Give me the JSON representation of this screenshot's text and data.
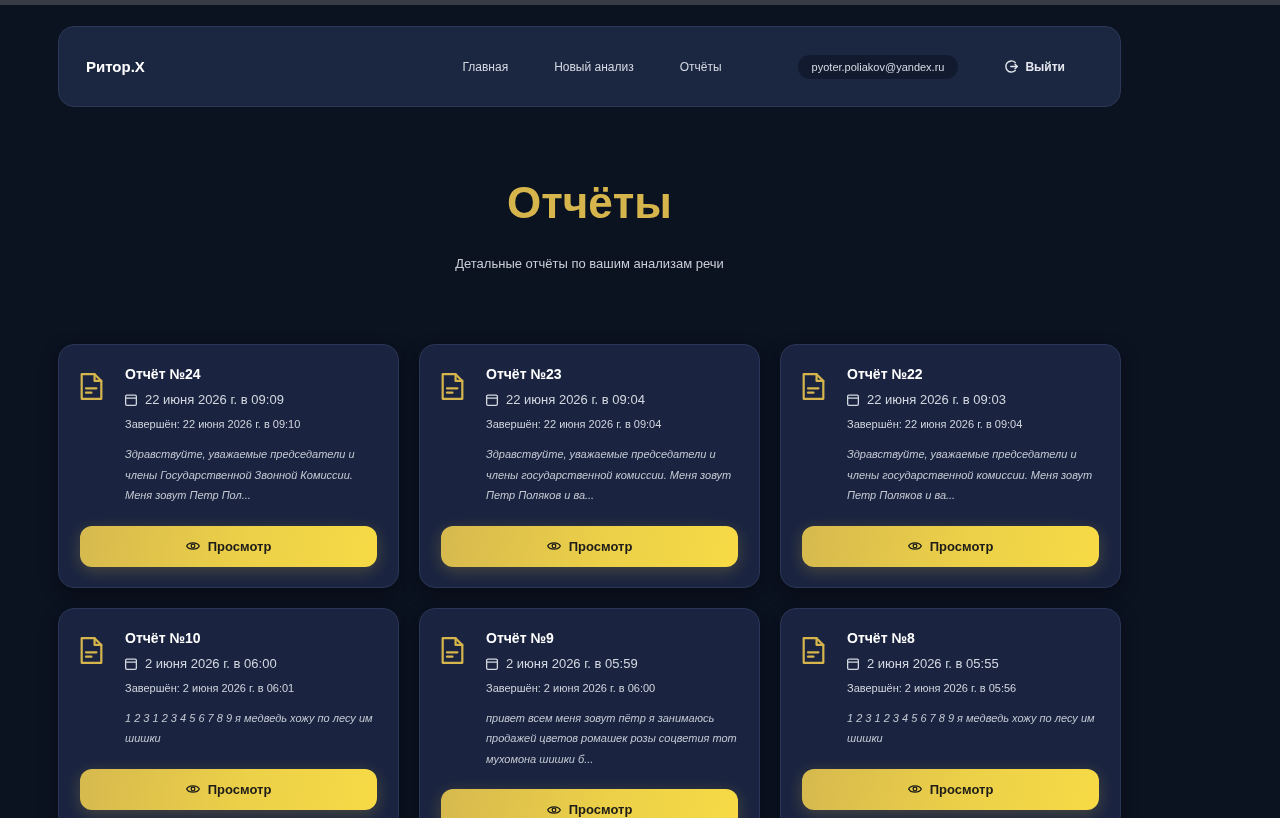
{
  "header": {
    "logo": "Ритор.Х",
    "nav": [
      {
        "label": "Главная"
      },
      {
        "label": "Новый анализ"
      },
      {
        "label": "Отчёты"
      }
    ],
    "user_email": "pyoter.poliakov@yandex.ru",
    "logout": "Выйти"
  },
  "page": {
    "title": "Отчёты",
    "subtitle": "Детальные отчёты по вашим анализам речи"
  },
  "reports": [
    {
      "title": "Отчёт №24",
      "created": "22 июня 2026 г. в 09:09",
      "completed": "Завершён: 22 июня 2026 г. в 09:10",
      "excerpt": "Здравствуйте, уважаемые председатели и члены Государственной Звонной Комиссии. Меня зовут Петр Пол...",
      "button": "Просмотр"
    },
    {
      "title": "Отчёт №23",
      "created": "22 июня 2026 г. в 09:04",
      "completed": "Завершён: 22 июня 2026 г. в 09:04",
      "excerpt": "Здравствуйте, уважаемые председатели и члены государственной комиссии. Меня зовут Петр Поляков и ва...",
      "button": "Просмотр"
    },
    {
      "title": "Отчёт №22",
      "created": "22 июня 2026 г. в 09:03",
      "completed": "Завершён: 22 июня 2026 г. в 09:04",
      "excerpt": "Здравствуйте, уважаемые председатели и члены государственной комиссии. Меня зовут Петр Поляков и ва...",
      "button": "Просмотр"
    },
    {
      "title": "Отчёт №10",
      "created": "2 июня 2026 г. в 06:00",
      "completed": "Завершён: 2 июня 2026 г. в 06:01",
      "excerpt": "1 2 3 1 2 3 4 5 6 7 8 9 я медведь хожу по лесу им шишки",
      "button": "Просмотр"
    },
    {
      "title": "Отчёт №9",
      "created": "2 июня 2026 г. в 05:59",
      "completed": "Завершён: 2 июня 2026 г. в 06:00",
      "excerpt": "привет всем меня зовут пётр я занимаюсь продажей цветов ромашек розы соцветия тот мухомона шишки б...",
      "button": "Просмотр"
    },
    {
      "title": "Отчёт №8",
      "created": "2 июня 2026 г. в 05:55",
      "completed": "Завершён: 2 июня 2026 г. в 05:56",
      "excerpt": "1 2 3 1 2 3 4 5 6 7 8 9 я медведь хожу по лесу им шишки",
      "button": "Просмотр"
    }
  ]
}
